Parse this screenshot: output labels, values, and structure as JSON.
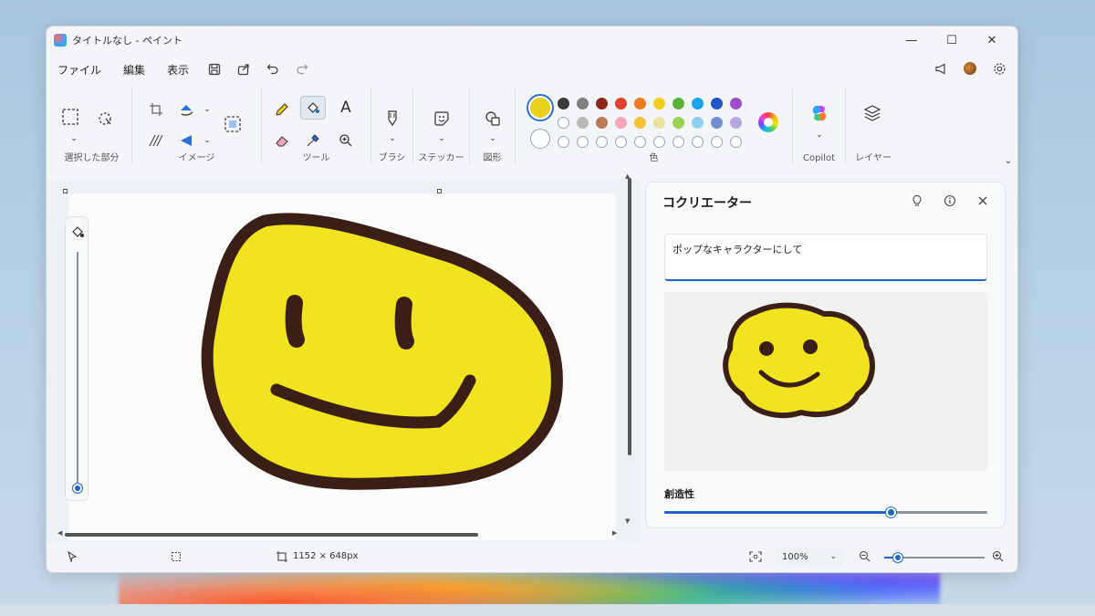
{
  "window": {
    "title": "タイトルなし - ペイント",
    "controls": {
      "minimize": "—",
      "maximize": "☐",
      "close": "✕"
    }
  },
  "menu": {
    "file": "ファイル",
    "edit": "編集",
    "view": "表示"
  },
  "ribbon": {
    "groups": {
      "selection": "選択した部分",
      "image": "イメージ",
      "tools": "ツール",
      "brushes": "ブラシ",
      "stickers": "ステッカー",
      "shapes": "図形",
      "colors": "色",
      "copilot": "Copilot",
      "layers": "レイヤー"
    },
    "text_tool_glyph": "A",
    "active_tool": "fill-bucket",
    "current_color": "#e8d11c",
    "palette_row1": [
      "#3a3a3a",
      "#7f7f7f",
      "#8b2a1a",
      "#e0412c",
      "#ee7b22",
      "#f2cf1a",
      "#5cb13a",
      "#1aa3e8",
      "#2156c2",
      "#9b4fc9"
    ],
    "palette_row2": [
      "#ffffff",
      "#b9b9b9",
      "#b97a57",
      "#f5a6b9",
      "#f3c13a",
      "#e8e29a",
      "#9bd14f",
      "#8fd0ee",
      "#6f8fd0",
      "#b6a6e0"
    ],
    "palette_row3_empty": 10
  },
  "canvas": {
    "fill_color": "#f2e31f",
    "outline_color": "#3a1f16"
  },
  "cocreator": {
    "title": "コクリエーター",
    "prompt": "ポップなキャラクターにして",
    "creativity_label": "創造性",
    "creativity_value": 0.7
  },
  "status": {
    "canvas_size": "1152 × 648px",
    "zoom": "100%",
    "zoom_level": 0.14
  }
}
